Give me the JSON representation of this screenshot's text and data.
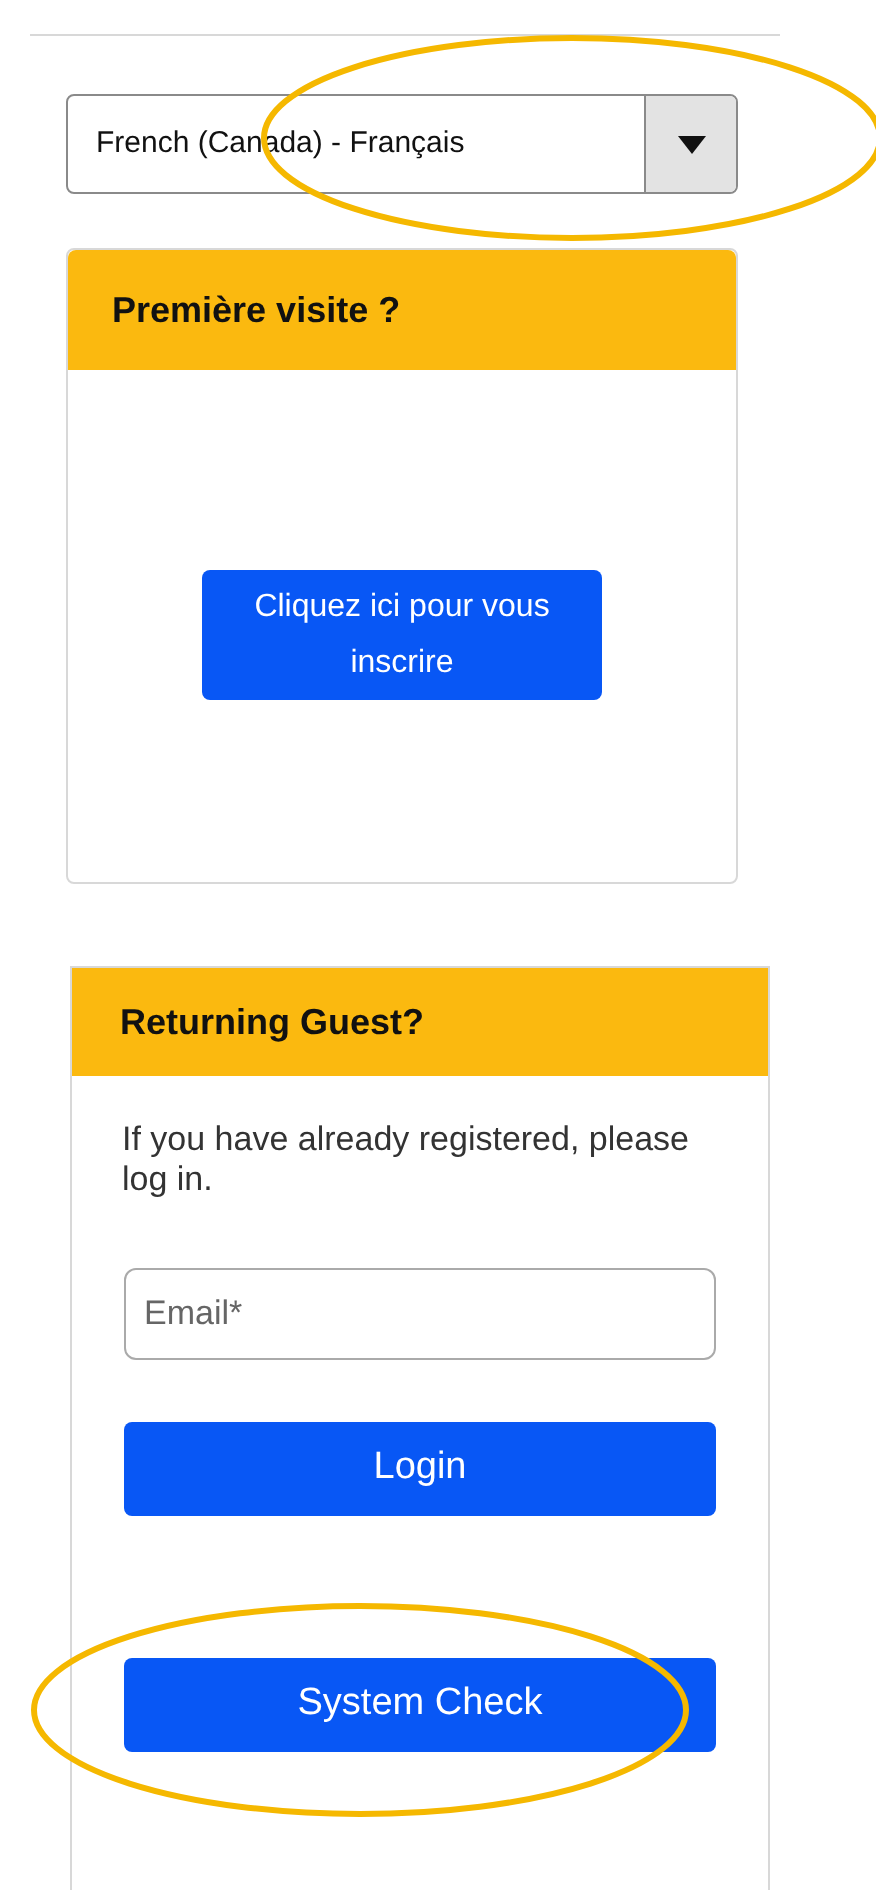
{
  "language_select": {
    "value": "French (Canada) - Français"
  },
  "first_visit": {
    "title": "Première visite ?",
    "button": "Cliquez ici pour vous inscrire"
  },
  "returning_guest": {
    "title": "Returning Guest?",
    "text": "If you have already registered, please log in.",
    "email": {
      "placeholder": "Email*"
    },
    "buttons": [
      "Login",
      "System Check"
    ]
  }
}
